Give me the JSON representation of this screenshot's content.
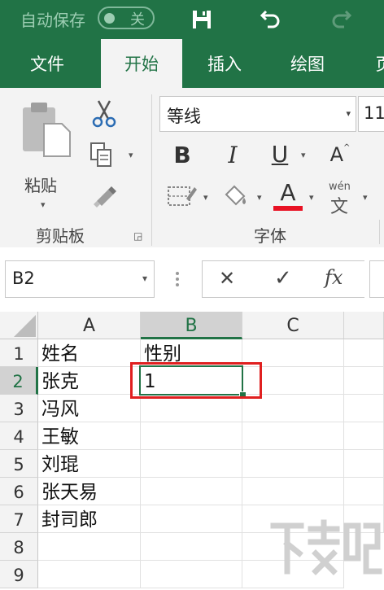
{
  "titlebar": {
    "autosave_label": "自动保存",
    "autosave_state": "关",
    "save_icon": "save-icon",
    "undo_icon": "undo-icon",
    "redo_icon": "redo-icon"
  },
  "tabs": [
    {
      "label": "文件"
    },
    {
      "label": "开始",
      "active": true
    },
    {
      "label": "插入"
    },
    {
      "label": "绘图"
    },
    {
      "label": "页"
    }
  ],
  "ribbon": {
    "clipboard": {
      "paste_label": "粘贴",
      "group_label": "剪贴板"
    },
    "font": {
      "font_name": "等线",
      "font_size": "11",
      "bold": "B",
      "italic": "I",
      "underline": "U",
      "grow": "A",
      "font_color": "A",
      "font_color_hex": "#e81123",
      "phonetic_top": "wén",
      "phonetic_bottom": "文",
      "group_label": "字体"
    }
  },
  "formula_bar": {
    "name_box": "B2",
    "cancel": "✕",
    "enter": "✓",
    "fx": "fx",
    "value": ""
  },
  "grid": {
    "columns": [
      "A",
      "B",
      "C"
    ],
    "rows": [
      "1",
      "2",
      "3",
      "4",
      "5",
      "6",
      "7",
      "8",
      "9"
    ],
    "cells": {
      "A1": "姓名",
      "B1": "性别",
      "A2": "张克",
      "B2": "1",
      "A3": "冯风",
      "A4": "王敏",
      "A5": "刘琨",
      "A6": "张天易",
      "A7": "封司郎"
    },
    "active_cell": "B2"
  },
  "watermark": {
    "text": "下载吧"
  },
  "colors": {
    "excel_green": "#217346",
    "highlight_red": "#e02020",
    "ribbon_bg": "#f3f3f3"
  }
}
